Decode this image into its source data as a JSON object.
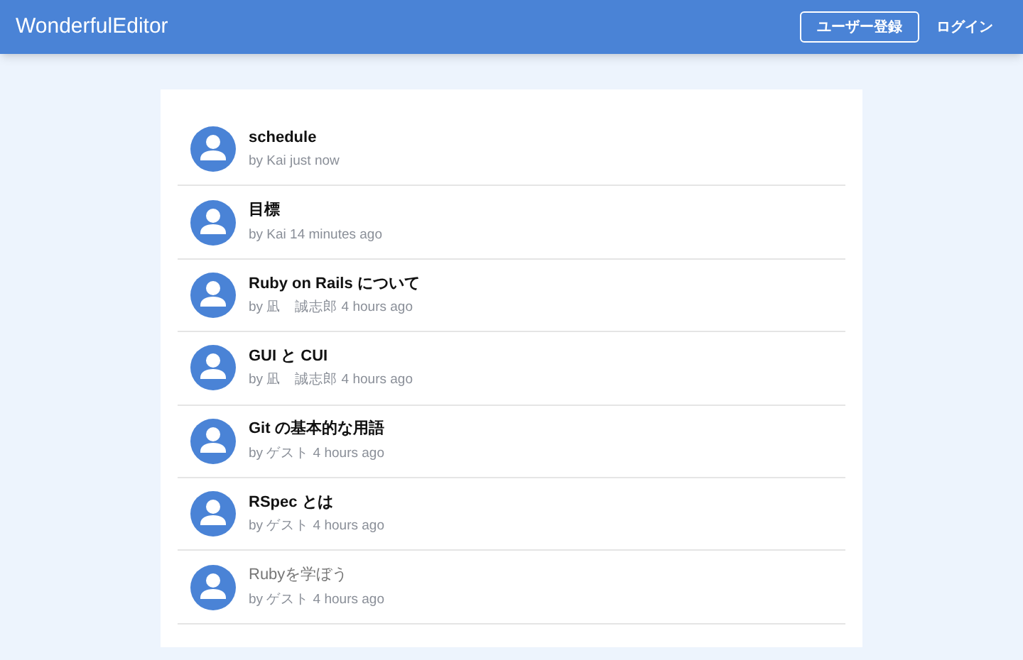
{
  "header": {
    "brand": "WonderfulEditor",
    "buttons": [
      "ユーザー登録"
    ],
    "links": [
      "ログイン"
    ]
  },
  "articles": [
    {
      "title": "schedule",
      "meta": "by Kai just now",
      "dimmed": false
    },
    {
      "title": "目標",
      "meta": "by Kai 14 minutes ago",
      "dimmed": false
    },
    {
      "title": "Ruby on Rails について",
      "meta": "by 凪　誠志郎 4 hours ago",
      "dimmed": false
    },
    {
      "title": "GUI と CUI",
      "meta": "by 凪　誠志郎 4 hours ago",
      "dimmed": false
    },
    {
      "title": "Git の基本的な用語",
      "meta": "by ゲスト 4 hours ago",
      "dimmed": false
    },
    {
      "title": "RSpec とは",
      "meta": "by ゲスト 4 hours ago",
      "dimmed": false
    },
    {
      "title": "Rubyを学ぼう",
      "meta": "by ゲスト 4 hours ago",
      "dimmed": true
    }
  ]
}
